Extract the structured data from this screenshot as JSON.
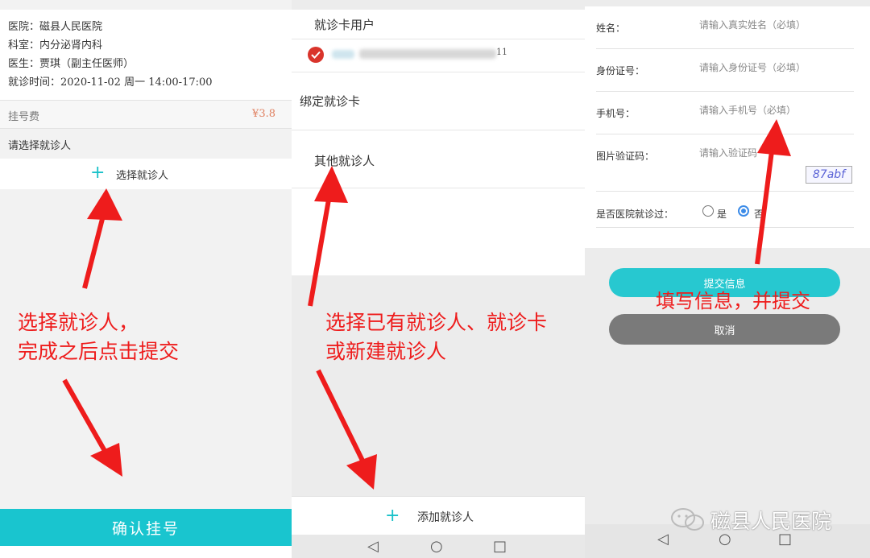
{
  "panel1": {
    "hospital": "医院：磁县人民医院",
    "department": "科室：内分泌肾内科",
    "doctor": "医生：贾琪（副主任医师）",
    "visit_time": "就诊时间：2020-11-02 周一 14:00-17:00",
    "fee_label": "挂号费",
    "fee_value": "¥3.8",
    "choose_prompt": "请选择就诊人",
    "plus_glyph": "+",
    "select_patient": "选择就诊人",
    "confirm_button": "确认挂号"
  },
  "panel2": {
    "card_users_title": "就诊卡用户",
    "card_tail": "11",
    "bind_card": "绑定就诊卡",
    "other_patients": "其他就诊人",
    "plus_glyph": "+",
    "add_patient": "添加就诊人",
    "nav_back": "◁",
    "nav_home": "○",
    "nav_recent": "□"
  },
  "panel3": {
    "name_label": "姓名：",
    "name_placeholder": "请输入真实姓名（必填）",
    "id_label": "身份证号：",
    "id_placeholder": "请输入身份证号（必填）",
    "phone_label": "手机号：",
    "phone_placeholder": "请输入手机号（必填）",
    "captcha_label": "图片验证码：",
    "captcha_placeholder": "请输入验证码",
    "captcha_text": "87abf",
    "visited_label": "是否医院就诊过：",
    "yes": "是",
    "no": "否",
    "submit_button": "提交信息",
    "cancel_button": "取消",
    "nav_back": "◁",
    "nav_home": "○",
    "nav_recent": "□"
  },
  "annotations": {
    "a1_line1": "选择就诊人，",
    "a1_line2": "完成之后点击提交",
    "a2_line1": "选择已有就诊人、就诊卡",
    "a2_line2": "或新建就诊人",
    "a3": "填写信息，并提交"
  },
  "watermark": "磁县人民医院",
  "colors": {
    "accent": "#19c5cf",
    "annotation": "#ee1c1c",
    "fee": "#e08060",
    "cancel": "#7a7a7a"
  }
}
